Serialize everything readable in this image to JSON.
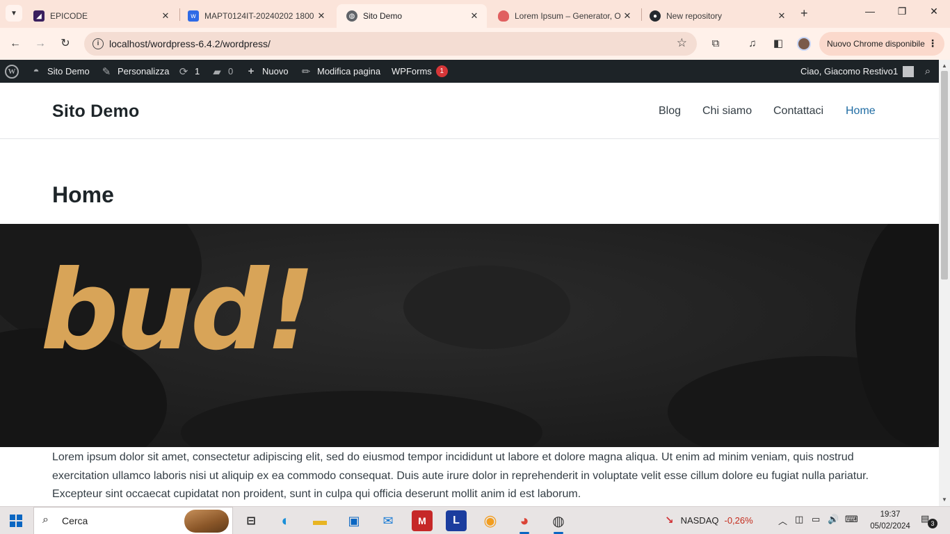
{
  "browser": {
    "tabs": [
      {
        "title": "EPICODE",
        "icon": "epicode-icon",
        "color": "#3a1f5e"
      },
      {
        "title": "MAPT0124IT-20240202 1800",
        "icon": "webflow-icon",
        "color": "#2e6ae6"
      },
      {
        "title": "Sito Demo",
        "icon": "globe-icon",
        "color": "#5f6368",
        "active": true
      },
      {
        "title": "Lorem Ipsum – Generator, O",
        "icon": "lorem-icon",
        "color": "#e06060"
      },
      {
        "title": "New repository",
        "icon": "github-icon",
        "color": "#24292f"
      }
    ],
    "url": "localhost/wordpress-6.4.2/wordpress/",
    "update_label": "Nuovo Chrome disponibile"
  },
  "admin_bar": {
    "site": "Sito Demo",
    "customize": "Personalizza",
    "updates_count": "1",
    "comments_count": "0",
    "new": "Nuovo",
    "edit": "Modifica pagina",
    "wpforms": "WPForms",
    "wpforms_badge": "1",
    "greeting": "Ciao, Giacomo Restivo1"
  },
  "site": {
    "title": "Sito Demo",
    "menu": [
      "Blog",
      "Chi siamo",
      "Contattaci",
      "Home"
    ]
  },
  "page": {
    "title": "Home",
    "hero_text": "bud!",
    "body": "Lorem ipsum dolor sit amet, consectetur adipiscing elit, sed do eiusmod tempor incididunt ut labore et dolore magna aliqua. Ut enim ad minim veniam, quis nostrud exercitation ullamco laboris nisi ut aliquip ex ea commodo consequat. Duis aute irure dolor in reprehenderit in voluptate velit esse cillum dolore eu fugiat nulla pariatur. Excepteur sint occaecat cupidatat non proident, sunt in culpa qui officia deserunt mollit anim id est laborum."
  },
  "taskbar": {
    "search_label": "Cerca",
    "ticker_name": "NASDAQ",
    "ticker_value": "-0,26%",
    "time": "19:37",
    "date": "05/02/2024",
    "notifications": "3"
  },
  "colors": {
    "hero_text": "#d8a458",
    "nav_current": "#1f6ca3",
    "admin_bar_bg": "#1d2327"
  }
}
